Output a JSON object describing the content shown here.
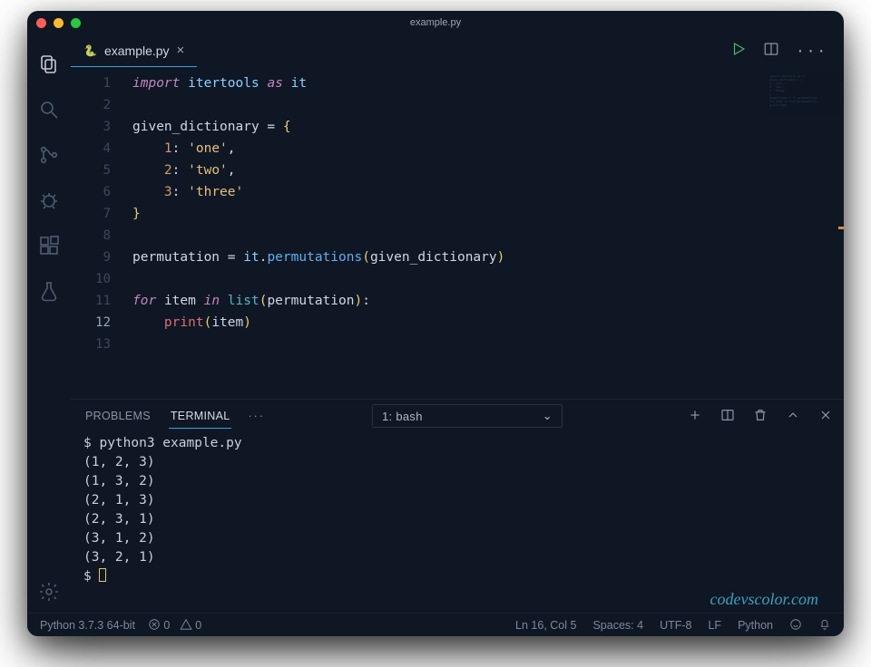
{
  "window": {
    "title": "example.py"
  },
  "tab": {
    "filename": "example.py"
  },
  "code": {
    "lines": [
      {
        "n": 1,
        "tokens": [
          [
            "kw",
            "import"
          ],
          [
            "sp",
            " "
          ],
          [
            "mod",
            "itertools"
          ],
          [
            "sp",
            " "
          ],
          [
            "kw",
            "as"
          ],
          [
            "sp",
            " "
          ],
          [
            "mod",
            "it"
          ]
        ]
      },
      {
        "n": 2,
        "tokens": []
      },
      {
        "n": 3,
        "tokens": [
          [
            "var",
            "given_dictionary"
          ],
          [
            "sp",
            " "
          ],
          [
            "op",
            "="
          ],
          [
            "sp",
            " "
          ],
          [
            "punc",
            "{"
          ]
        ]
      },
      {
        "n": 4,
        "tokens": [
          [
            "indent",
            "    "
          ],
          [
            "num",
            "1"
          ],
          [
            "op",
            ":"
          ],
          [
            "sp",
            " "
          ],
          [
            "str",
            "'one'"
          ],
          [
            "op",
            ","
          ]
        ]
      },
      {
        "n": 5,
        "tokens": [
          [
            "indent",
            "    "
          ],
          [
            "num",
            "2"
          ],
          [
            "op",
            ":"
          ],
          [
            "sp",
            " "
          ],
          [
            "str",
            "'two'"
          ],
          [
            "op",
            ","
          ]
        ]
      },
      {
        "n": 6,
        "tokens": [
          [
            "indent",
            "    "
          ],
          [
            "num",
            "3"
          ],
          [
            "op",
            ":"
          ],
          [
            "sp",
            " "
          ],
          [
            "str",
            "'three'"
          ]
        ]
      },
      {
        "n": 7,
        "tokens": [
          [
            "punc",
            "}"
          ]
        ]
      },
      {
        "n": 8,
        "tokens": []
      },
      {
        "n": 9,
        "tokens": [
          [
            "var",
            "permutation"
          ],
          [
            "sp",
            " "
          ],
          [
            "op",
            "="
          ],
          [
            "sp",
            " "
          ],
          [
            "mod",
            "it"
          ],
          [
            "op",
            "."
          ],
          [
            "func",
            "permutations"
          ],
          [
            "paren",
            "("
          ],
          [
            "var",
            "given_dictionary"
          ],
          [
            "paren",
            ")"
          ]
        ]
      },
      {
        "n": 10,
        "tokens": []
      },
      {
        "n": 11,
        "tokens": [
          [
            "kw2",
            "for"
          ],
          [
            "sp",
            " "
          ],
          [
            "var",
            "item"
          ],
          [
            "sp",
            " "
          ],
          [
            "kw2",
            "in"
          ],
          [
            "sp",
            " "
          ],
          [
            "builtin",
            "list"
          ],
          [
            "paren",
            "("
          ],
          [
            "var",
            "permutation"
          ],
          [
            "paren",
            ")"
          ],
          [
            "op",
            ":"
          ]
        ]
      },
      {
        "n": 12,
        "tokens": [
          [
            "indent",
            "    "
          ],
          [
            "call",
            "print"
          ],
          [
            "paren",
            "("
          ],
          [
            "var",
            "item"
          ],
          [
            "paren",
            ")"
          ]
        ]
      },
      {
        "n": 13,
        "tokens": []
      }
    ],
    "current_line": 12
  },
  "panel": {
    "tabs": {
      "problems": "PROBLEMS",
      "terminal": "TERMINAL"
    },
    "select": "1: bash"
  },
  "terminal": {
    "command": "$ python3 example.py",
    "output": [
      "(1, 2, 3)",
      "(1, 3, 2)",
      "(2, 1, 3)",
      "(2, 3, 1)",
      "(3, 1, 2)",
      "(3, 2, 1)"
    ],
    "prompt": "$ "
  },
  "watermark": "codevscolor.com",
  "status": {
    "interpreter": "Python 3.7.3 64-bit",
    "errors": "0",
    "warnings": "0",
    "position": "Ln 16, Col 5",
    "spaces": "Spaces: 4",
    "encoding": "UTF-8",
    "eol": "LF",
    "language": "Python"
  }
}
